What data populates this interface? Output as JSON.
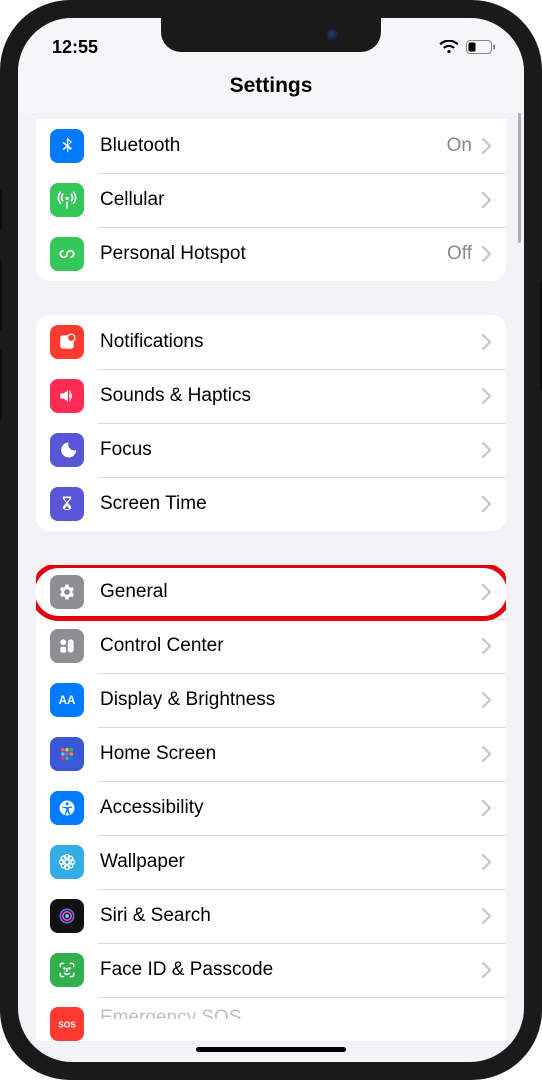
{
  "status": {
    "time": "12:55"
  },
  "header": {
    "title": "Settings"
  },
  "groups": [
    {
      "rows": [
        {
          "icon": "bluetooth-icon",
          "label": "Bluetooth",
          "detail": "On"
        },
        {
          "icon": "cellular-icon",
          "label": "Cellular",
          "detail": ""
        },
        {
          "icon": "hotspot-icon",
          "label": "Personal Hotspot",
          "detail": "Off"
        }
      ]
    },
    {
      "rows": [
        {
          "icon": "notifications-icon",
          "label": "Notifications",
          "detail": ""
        },
        {
          "icon": "sounds-icon",
          "label": "Sounds & Haptics",
          "detail": ""
        },
        {
          "icon": "focus-icon",
          "label": "Focus",
          "detail": ""
        },
        {
          "icon": "screentime-icon",
          "label": "Screen Time",
          "detail": ""
        }
      ]
    },
    {
      "rows": [
        {
          "icon": "general-icon",
          "label": "General",
          "detail": "",
          "highlighted": true
        },
        {
          "icon": "controlcenter-icon",
          "label": "Control Center",
          "detail": ""
        },
        {
          "icon": "display-icon",
          "label": "Display & Brightness",
          "detail": ""
        },
        {
          "icon": "homescreen-icon",
          "label": "Home Screen",
          "detail": ""
        },
        {
          "icon": "accessibility-icon",
          "label": "Accessibility",
          "detail": ""
        },
        {
          "icon": "wallpaper-icon",
          "label": "Wallpaper",
          "detail": ""
        },
        {
          "icon": "siri-icon",
          "label": "Siri & Search",
          "detail": ""
        },
        {
          "icon": "faceid-icon",
          "label": "Face ID & Passcode",
          "detail": ""
        },
        {
          "icon": "sos-icon",
          "label": "Emergency SOS",
          "detail": ""
        }
      ]
    }
  ]
}
